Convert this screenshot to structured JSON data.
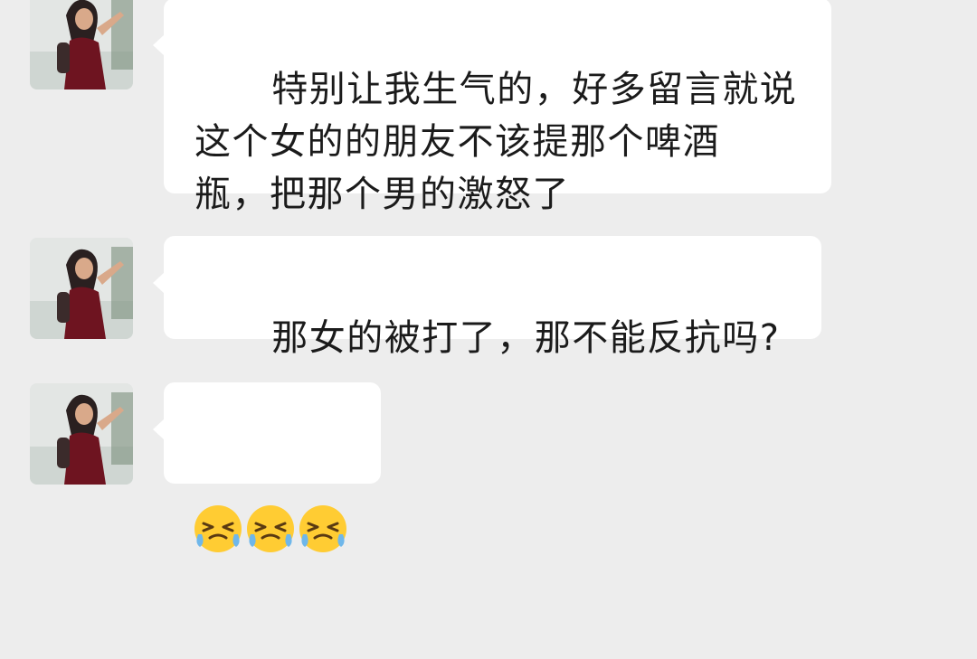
{
  "messages": [
    {
      "sender": "contact",
      "text": "特别让我生气的，好多留言就说\n这个女的的朋友不该提那个啤酒\n瓶，把那个男的激怒了"
    },
    {
      "sender": "contact",
      "text": "那女的被打了，那不能反抗吗?"
    },
    {
      "sender": "contact",
      "emoji": [
        "crying-laughing-emoji",
        "crying-laughing-emoji",
        "crying-laughing-emoji"
      ]
    }
  ],
  "colors": {
    "background": "#ededed",
    "bubble": "#ffffff",
    "text": "#1b1b1b",
    "emoji_face": "#ffcc33",
    "emoji_tear": "#6fb7ea"
  }
}
